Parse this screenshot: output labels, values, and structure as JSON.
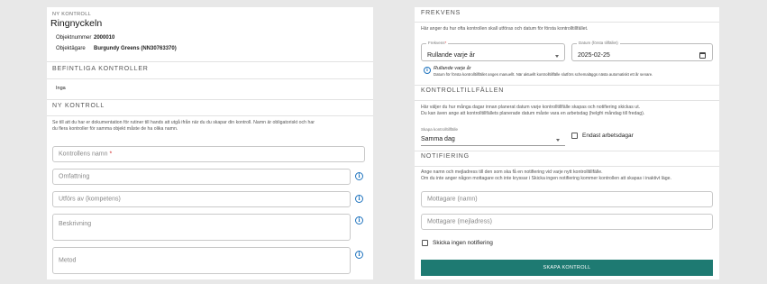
{
  "left": {
    "eyebrow": "NY KONTROLL",
    "title": "Ringnyckeln",
    "object_number_label": "Objektnummer",
    "object_number_value": "2000010",
    "object_owner_label": "Objektägare",
    "object_owner_value": "Burgundy Greens (NN30763370)",
    "existing_heading": "BEFINTLIGA KONTROLLER",
    "existing_value": "Inga",
    "new_heading": "NY KONTROLL",
    "new_para_line1": "Se till att du har er dokumentation för rutiner till hands att utgå ifrån när du du skapar din kontroll. Namn är obligatoriskt och har",
    "new_para_line2": "du flera kontroller för samma objekt måste de ha olika namn.",
    "fields": {
      "name_placeholder": "Kontrollens namn",
      "name_required_mark": "*",
      "scope_placeholder": "Omfattning",
      "performer_placeholder": "Utförs av (kompetens)",
      "description_placeholder": "Beskrivning",
      "method_placeholder": "Metod"
    }
  },
  "right": {
    "freq_heading": "FREKVENS",
    "freq_para": "Här anger du hur ofta kontrollen skall utföras och datum för första kontrolltillfället.",
    "freq_select_label": "Frekvens",
    "freq_select_required": "*",
    "freq_select_value": "Rullande varje år",
    "date_label": "Datum (första tillfället)",
    "date_value": "2025-02-25",
    "info_title": "Rullande varje år",
    "info_text": "Datum för första kontrolltillfället anges manuellt. När aktuellt kontrolltillfälle slutförs schemaläggs nästa automatiskt ett år senare.",
    "occ_heading": "KONTROLLTILLFÄLLEN",
    "occ_para_line1": "Här väljer du hur många dagar innan planerat datum varje kontrolltillfälle skapas och notifiering skickas ut.",
    "occ_para_line2": "Du kan även ange att kontrolltillfällets planerade datum måste vara en arbetsdag (helgfri måndag till fredag).",
    "create_select_label": "Skapa kontrolltillfälle",
    "create_select_value": "Samma dag",
    "workdays_label": "Endast arbetsdagar",
    "notif_heading": "NOTIFIERING",
    "notif_para_line1": "Ange namn och mejladress till den som ska få en notifiering vid varje nytt kontrolltillfälle.",
    "notif_para_line2": "Om du inte anger någon mottagare och inte kryssar i Skicka ingen notifiering kommer kontrollen att skapas i inaktivt läge.",
    "recipient_name_placeholder": "Mottagare (namn)",
    "recipient_email_placeholder": "Mottagare (mejladress)",
    "no_notification_label": "Skicka ingen notifiering",
    "submit_label": "SKAPA KONTROLL"
  },
  "colors": {
    "accent": "#1e7a72",
    "info": "#1e73be",
    "required": "#d32f2f"
  },
  "icons": {
    "info": "info-circle-icon",
    "calendar": "calendar-icon",
    "caret": "chevron-down-icon"
  }
}
